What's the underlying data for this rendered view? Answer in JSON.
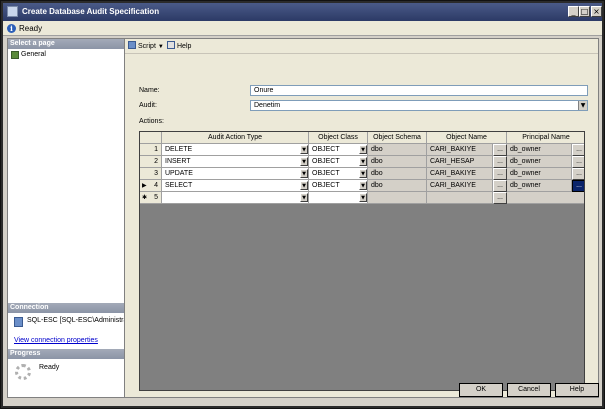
{
  "window": {
    "title": "Create Database Audit Specification"
  },
  "status": {
    "text": "Ready"
  },
  "left_pane": {
    "select_page_header": "Select a page",
    "pages": [
      {
        "label": "General",
        "icon": "page-icon"
      }
    ],
    "connection_header": "Connection",
    "connection_server": "SQL-ESC [SQL-ESC\\Administrator]",
    "view_connection_link": "View connection properties",
    "progress_header": "Progress",
    "progress_status": "Ready"
  },
  "toolbar": {
    "script_label": "Script",
    "help_label": "Help"
  },
  "form": {
    "name_label": "Name:",
    "name_value": "Onure",
    "audit_label": "Audit:",
    "audit_value": "Denetim",
    "actions_label": "Actions:"
  },
  "grid": {
    "columns": [
      "Audit Action Type",
      "Object Class",
      "Object Schema",
      "Object Name",
      "Principal Name"
    ],
    "rows": [
      {
        "num": "1",
        "marker": "",
        "action": "DELETE",
        "class": "OBJECT",
        "schema": "dbo",
        "name": "CARI_BAKIYE",
        "principal": "db_owner"
      },
      {
        "num": "2",
        "marker": "",
        "action": "INSERT",
        "class": "OBJECT",
        "schema": "dbo",
        "name": "CARI_HESAP",
        "principal": "db_owner"
      },
      {
        "num": "3",
        "marker": "",
        "action": "UPDATE",
        "class": "OBJECT",
        "schema": "dbo",
        "name": "CARI_BAKIYE",
        "principal": "db_owner"
      },
      {
        "num": "4",
        "marker": "▶",
        "action": "SELECT",
        "class": "OBJECT",
        "schema": "dbo",
        "name": "CARI_BAKIYE",
        "principal": "db_owner"
      },
      {
        "num": "5",
        "marker": "✱",
        "action": "",
        "class": "",
        "schema": "",
        "name": "",
        "principal": ""
      }
    ],
    "ellipsis": "..."
  },
  "buttons": {
    "ok": "OK",
    "cancel": "Cancel",
    "help": "Help"
  },
  "glyphs": {
    "dropdown": "▼",
    "minimize": "_",
    "maximize": "□",
    "close": "×"
  },
  "colors": {
    "title_bar": "#2c3a66",
    "selection": "#0a246a",
    "link": "#0000cc"
  }
}
